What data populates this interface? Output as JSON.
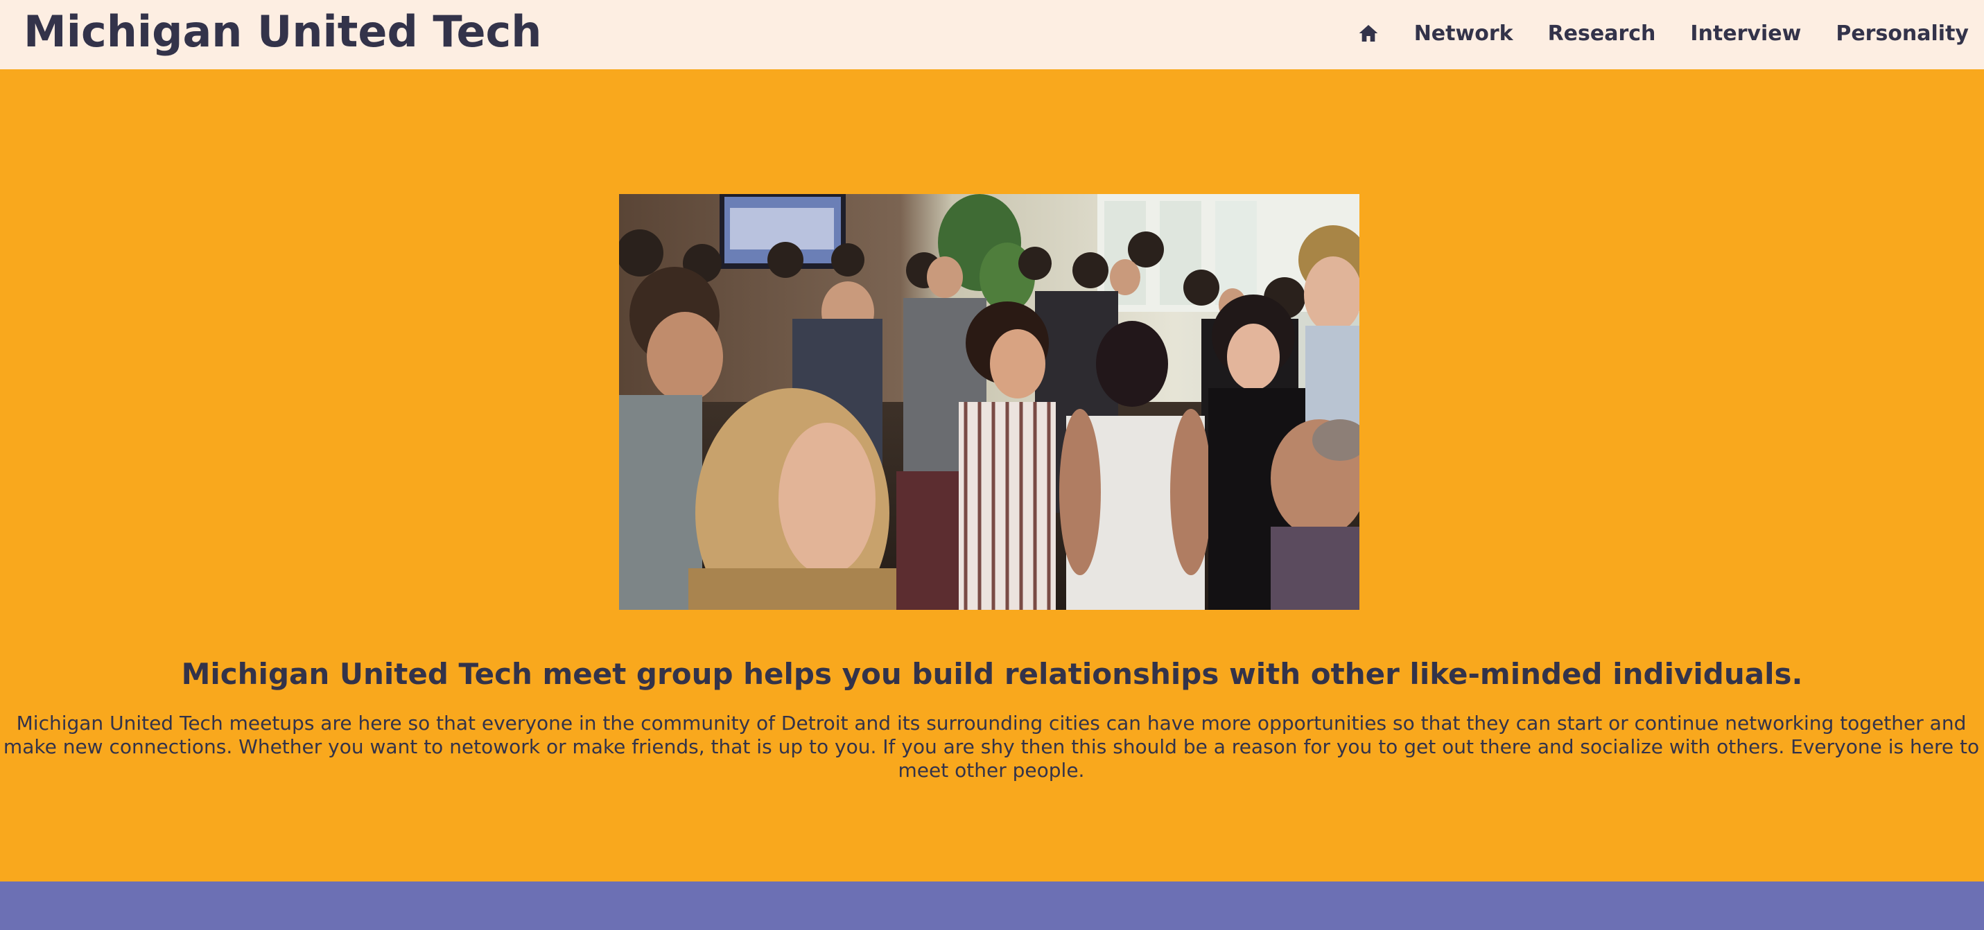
{
  "header": {
    "brand": "Michigan United Tech",
    "nav": {
      "home_icon": "home-icon",
      "items": [
        "Network",
        "Research",
        "Interview",
        "Personality"
      ]
    }
  },
  "hero": {
    "image": "networking-event-crowd-photo",
    "headline": "Michigan United Tech meet group helps you build relationships with other like-minded individuals.",
    "body": "Michigan United Tech meetups are here so that everyone in the community of Detroit and its surrounding cities can have more opportunities so that they can start or continue networking together and make new connections. Whether you want to netowork or make friends, that is up to you. If you are shy then this should be a reason for you to get out there and socialize with others. Everyone is here to meet other people."
  },
  "colors": {
    "header_bg": "#fdeee2",
    "hero_bg": "#f9a81d",
    "footer_bg": "#6c70b4",
    "text": "#33334a"
  }
}
